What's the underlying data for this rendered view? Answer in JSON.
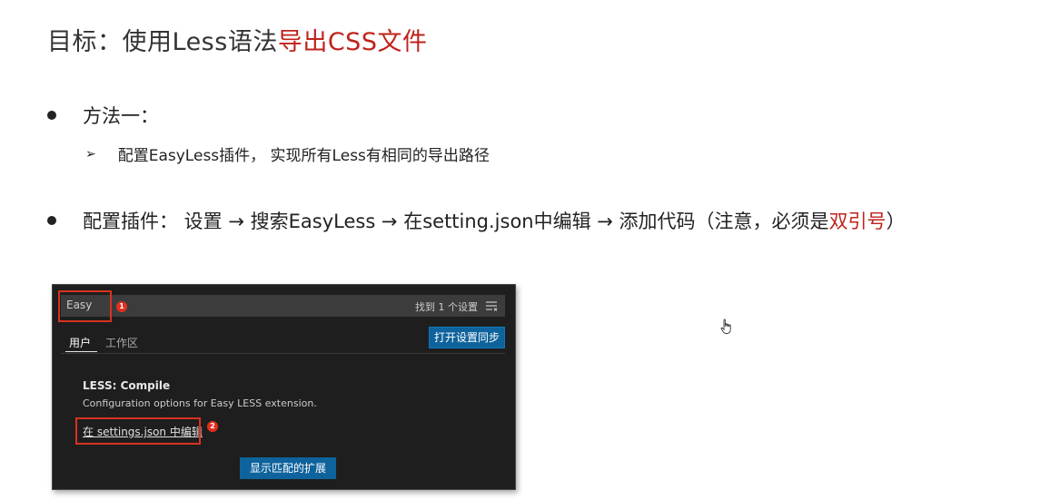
{
  "title": {
    "prefix": "目标：使用Less语法",
    "accent": "导出CSS文件"
  },
  "bullets": {
    "method_one": "方法一：",
    "method_one_sub": "配置EasyLess插件， 实现所有Less有相同的导出路径",
    "sub_marker": "➢",
    "config_prefix": "配置插件： 设置 → 搜索EasyLess → 在setting.json中编辑 → 添加代码（注意，必须是",
    "config_accent": "双引号",
    "config_suffix": "）"
  },
  "vscode": {
    "search_value": "Easy",
    "found_text": "找到 1 个设置",
    "tabs": [
      "用户",
      "工作区"
    ],
    "sync_button": "打开设置同步",
    "setting_title": "LESS: Compile",
    "setting_desc": "Configuration options for Easy LESS extension.",
    "edit_link": "在 settings.json 中编辑",
    "ext_button": "显示匹配的扩展",
    "badges": [
      "1",
      "2"
    ],
    "colors": {
      "background": "#1e1e1e",
      "button": "#0e639c",
      "highlight": "#d7321f"
    }
  },
  "icons": {
    "filter": "filter-list-icon",
    "cursor": "hand-pointer-icon"
  },
  "colors": {
    "accent_red": "#c0221b"
  }
}
